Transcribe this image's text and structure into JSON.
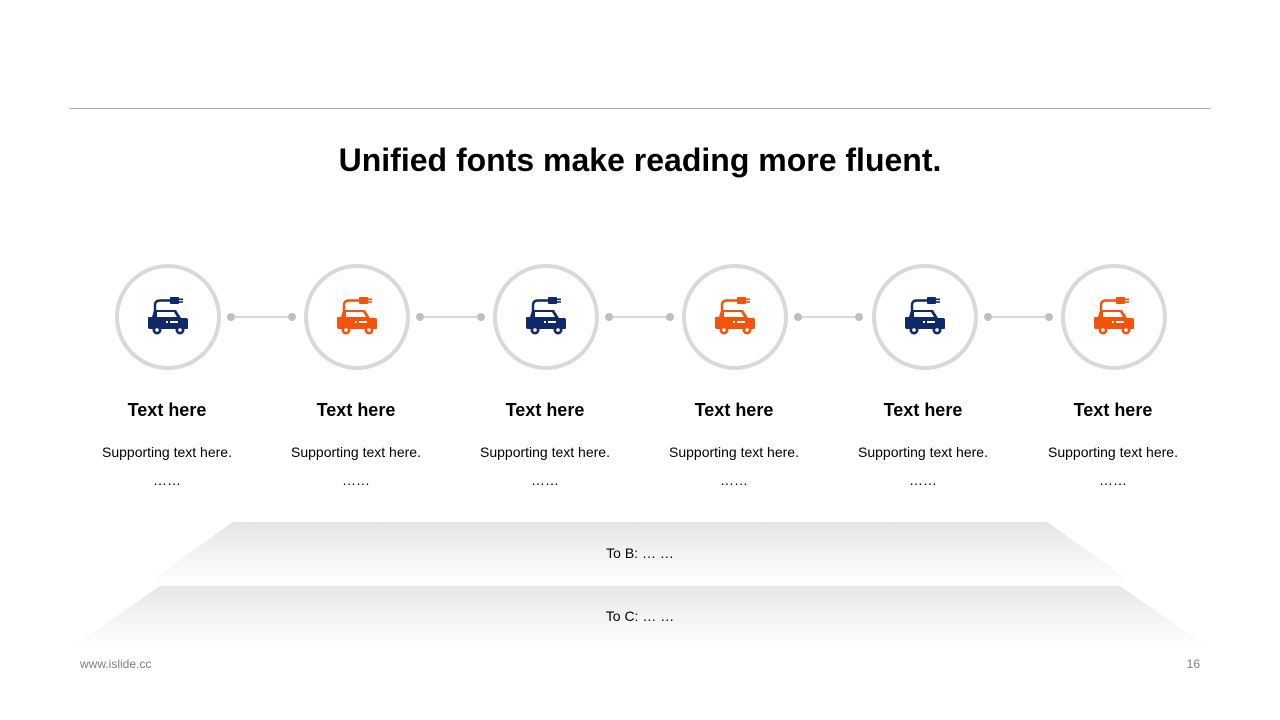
{
  "title": "Unified fonts make reading more fluent.",
  "colors": {
    "navy": "#0e2a6b",
    "orange": "#f5520a",
    "ring": "#d9d9d9"
  },
  "steps": [
    {
      "title": "Text here",
      "text": "Supporting  text here.",
      "ellipsis": "……",
      "icon": "electric-car-icon",
      "color": "navy"
    },
    {
      "title": "Text here",
      "text": "Supporting  text here.",
      "ellipsis": "……",
      "icon": "electric-car-icon",
      "color": "orange"
    },
    {
      "title": "Text here",
      "text": "Supporting  text here.",
      "ellipsis": "……",
      "icon": "electric-car-icon",
      "color": "navy"
    },
    {
      "title": "Text here",
      "text": "Supporting  text here.",
      "ellipsis": "……",
      "icon": "electric-car-icon",
      "color": "orange"
    },
    {
      "title": "Text here",
      "text": "Supporting  text here.",
      "ellipsis": "……",
      "icon": "electric-car-icon",
      "color": "navy"
    },
    {
      "title": "Text here",
      "text": "Supporting  text here.",
      "ellipsis": "……",
      "icon": "electric-car-icon",
      "color": "orange"
    }
  ],
  "bands": [
    {
      "label": "To B: … …"
    },
    {
      "label": "To C: … …"
    }
  ],
  "footer": {
    "url": "www.islide.cc",
    "page": "16"
  }
}
